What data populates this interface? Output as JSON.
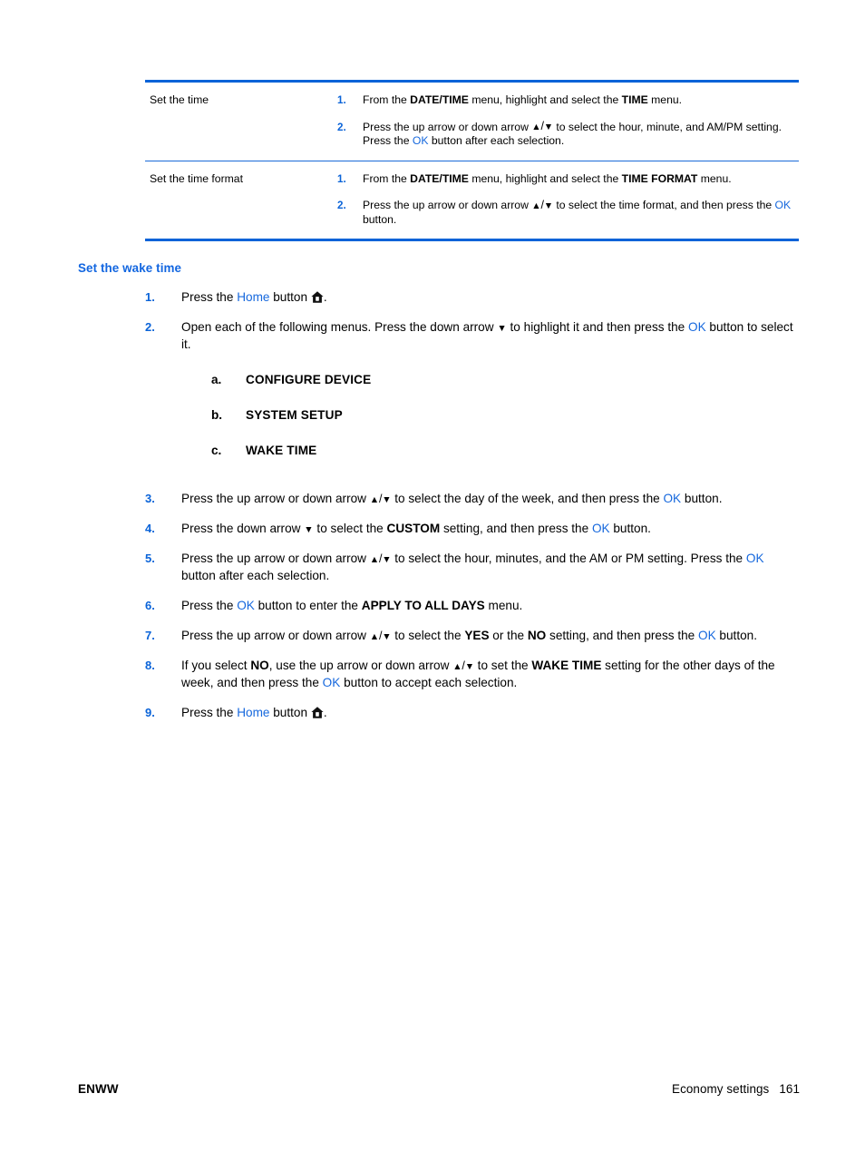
{
  "document": {
    "page_number": "161",
    "footer_left": "ENWW",
    "footer_section": "Economy settings"
  },
  "colors": {
    "accent_blue": "#0a63d8",
    "link_blue": "#1668dd",
    "heading_blue": "#1266e0",
    "text_black": "#000000",
    "page_background": "#ffffff"
  },
  "procedure_table": {
    "rows": [
      {
        "label": "Set the time",
        "steps": [
          {
            "number": "1.",
            "segments": [
              {
                "text": "From the ",
                "style": "normal"
              },
              {
                "text": "DATE/TIME",
                "style": "bold"
              },
              {
                "text": " menu, highlight and select the ",
                "style": "normal"
              },
              {
                "text": "TIME",
                "style": "bold"
              },
              {
                "text": " menu.",
                "style": "normal"
              }
            ],
            "plain": "From the DATE/TIME menu, highlight and select the TIME menu."
          },
          {
            "number": "2.",
            "segments": [
              {
                "text": "Press the up arrow or down arrow ",
                "style": "normal"
              },
              {
                "text": "▲/▼",
                "style": "icon-arrow-up-down"
              },
              {
                "text": " to select the hour, minute, and AM/PM setting. Press the ",
                "style": "normal"
              },
              {
                "text": "OK",
                "style": "blue"
              },
              {
                "text": " button after each selection.",
                "style": "normal"
              }
            ],
            "plain": "Press the up arrow or down arrow ▲/▼ to select the hour, minute, and AM/PM setting. Press the OK button after each selection."
          }
        ]
      },
      {
        "label": "Set the time format",
        "steps": [
          {
            "number": "1.",
            "segments": [
              {
                "text": "From the ",
                "style": "normal"
              },
              {
                "text": "DATE/TIME",
                "style": "bold"
              },
              {
                "text": " menu, highlight and select the ",
                "style": "normal"
              },
              {
                "text": "TIME FORMAT",
                "style": "bold"
              },
              {
                "text": " menu.",
                "style": "normal"
              }
            ],
            "plain": "From the DATE/TIME menu, highlight and select the TIME FORMAT menu."
          },
          {
            "number": "2.",
            "segments": [
              {
                "text": "Press the up arrow or down arrow ",
                "style": "normal"
              },
              {
                "text": "▲/▼",
                "style": "icon-arrow-up-down"
              },
              {
                "text": " to select the time format, and then press the ",
                "style": "normal"
              },
              {
                "text": "OK",
                "style": "blue"
              },
              {
                "text": " button.",
                "style": "normal"
              }
            ],
            "plain": "Press the up arrow or down arrow ▲/▼ to select the time format, and then press the OK button."
          }
        ]
      }
    ]
  },
  "section": {
    "heading": "Set the wake time",
    "steps": [
      {
        "number": "1.",
        "plain": "Press the Home button 🏠."
      },
      {
        "number": "2.",
        "plain": "Open each of the following menus. Press the down arrow ▼ to highlight it and then press the OK button to select it."
      },
      {
        "number": "3.",
        "plain": "Press the up arrow or down arrow ▲/▼ to select the day of the week, and then press the OK button."
      },
      {
        "number": "4.",
        "plain": "Press the down arrow ▼ to select the CUSTOM setting, and then press the OK button."
      },
      {
        "number": "5.",
        "plain": "Press the up arrow or down arrow ▲/▼ to select the hour, minutes, and the AM or PM setting. Press the OK button after each selection."
      },
      {
        "number": "6.",
        "plain": "Press the OK button to enter the APPLY TO ALL DAYS menu."
      },
      {
        "number": "7.",
        "plain": "Press the up arrow or down arrow ▲/▼ to select the YES or the NO setting, and then press the OK button."
      },
      {
        "number": "8.",
        "plain": "If you select NO, use the up arrow or down arrow ▲/▼ to set the WAKE TIME setting for the other days of the week, and then press the OK button to accept each selection."
      },
      {
        "number": "9.",
        "plain": "Press the Home button 🏠."
      }
    ],
    "substeps": [
      {
        "marker": "a.",
        "label": "CONFIGURE DEVICE"
      },
      {
        "marker": "b.",
        "label": "SYSTEM SETUP"
      },
      {
        "marker": "c.",
        "label": "WAKE TIME"
      }
    ],
    "phrases": {
      "press_the": "Press the ",
      "home": "Home",
      "button_period": " button ",
      "period": ".",
      "ok": "OK",
      "s2_a": "Open each of the following menus. Press the down arrow ",
      "s2_b": " to highlight it and then press the ",
      "s2_c": " button to select it.",
      "s3_a": "Press the up arrow or down arrow ",
      "s3_b": " to select the day of the week, and then press the ",
      "s3_c": " button.",
      "s4_a": "Press the down arrow ",
      "s4_b": " to select the ",
      "s4_custom": "CUSTOM",
      "s4_c": " setting, and then press the ",
      "s4_d": " button.",
      "s5_a": "Press the up arrow or down arrow ",
      "s5_b": " to select the hour, minutes, and the AM or PM setting. Press the ",
      "s5_c": " button after each selection.",
      "s6_a": "Press the ",
      "s6_b": " button to enter the ",
      "s6_apply": "APPLY TO ALL DAYS",
      "s6_c": " menu.",
      "s7_a": "Press the up arrow or down arrow ",
      "s7_b": " to select the ",
      "s7_yes": "YES",
      "s7_c": " or the ",
      "s7_no": "NO",
      "s7_d": " setting, and then press the ",
      "s7_e": " button.",
      "s8_a": "If you select ",
      "s8_no": "NO",
      "s8_b": ", use the up arrow or down arrow ",
      "s8_c": " to set the ",
      "s8_wake": "WAKE TIME",
      "s8_d": " setting for the other days of the week, and then press the ",
      "s8_e": " button to accept each selection."
    }
  },
  "glyphs": {
    "arrow_up": "▲",
    "arrow_down": "▼",
    "arrow_sep": "/",
    "home_icon_name": "home-icon"
  }
}
